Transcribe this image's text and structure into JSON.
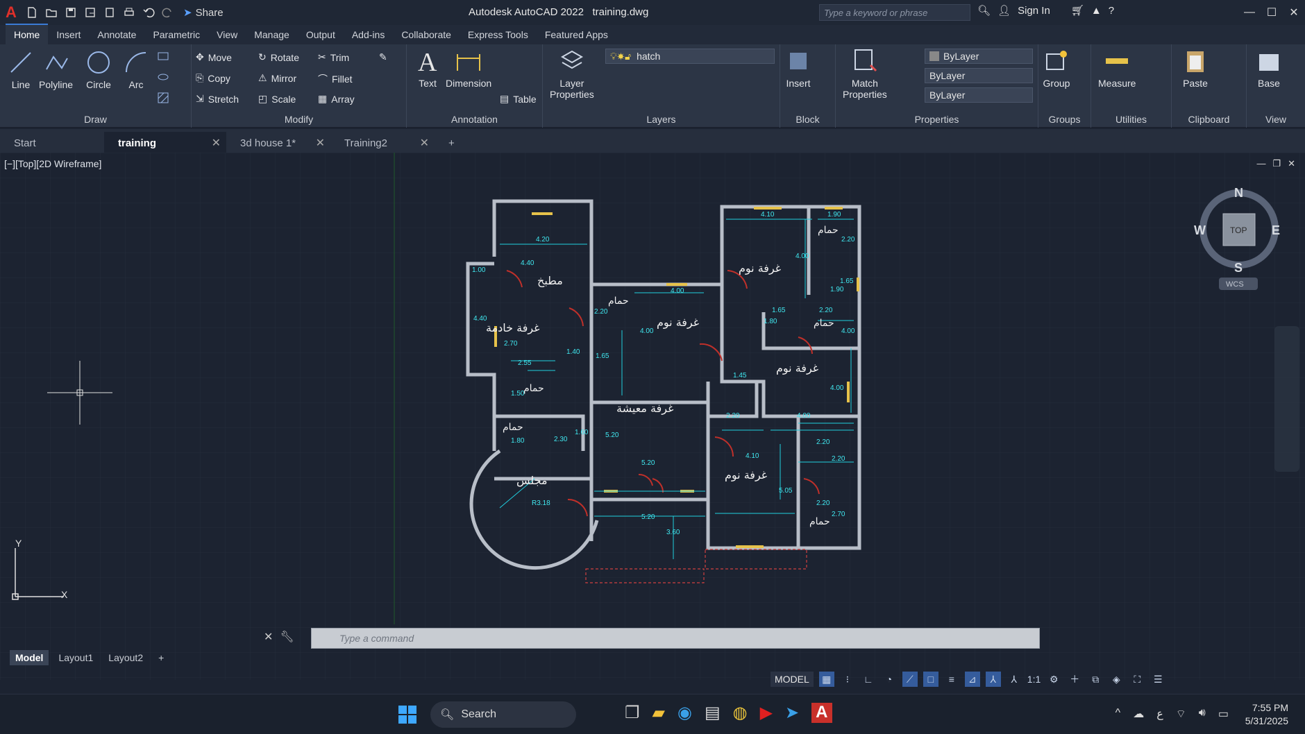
{
  "app": {
    "title": "Autodesk AutoCAD 2022",
    "file": "training.dwg",
    "share": "Share",
    "search_placeholder": "Type a keyword or phrase",
    "sign_in": "Sign In"
  },
  "ribbon_tabs": [
    "Home",
    "Insert",
    "Annotate",
    "Parametric",
    "View",
    "Manage",
    "Output",
    "Add-ins",
    "Collaborate",
    "Express Tools",
    "Featured Apps"
  ],
  "panels": {
    "draw": "Draw",
    "modify": "Modify",
    "annotation": "Annotation",
    "layers": "Layers",
    "block": "Block",
    "properties": "Properties",
    "groups": "Groups",
    "utilities": "Utilities",
    "clipboard": "Clipboard",
    "view": "View"
  },
  "draw_tools": {
    "line": "Line",
    "polyline": "Polyline",
    "circle": "Circle",
    "arc": "Arc"
  },
  "modify_tools": {
    "move": "Move",
    "rotate": "Rotate",
    "trim": "Trim",
    "copy": "Copy",
    "mirror": "Mirror",
    "fillet": "Fillet",
    "stretch": "Stretch",
    "scale": "Scale",
    "array": "Array"
  },
  "annotation_tools": {
    "text": "Text",
    "dimension": "Dimension",
    "table": "Table"
  },
  "layers_tools": {
    "layer_properties_1": "Layer",
    "layer_properties_2": "Properties",
    "current_layer": "hatch"
  },
  "block_tools": {
    "insert": "Insert"
  },
  "properties_tools": {
    "match_1": "Match",
    "match_2": "Properties",
    "color": "ByLayer",
    "linetype": "ByLayer",
    "lineweight": "ByLayer"
  },
  "group_tools": {
    "group": "Group"
  },
  "utility_tools": {
    "measure": "Measure"
  },
  "clipboard_tools": {
    "paste": "Paste"
  },
  "view_tools": {
    "base": "Base"
  },
  "doc_tabs": [
    {
      "label": "Start"
    },
    {
      "label": "training"
    },
    {
      "label": "3d house 1*"
    },
    {
      "label": "Training2"
    }
  ],
  "viewport": {
    "label": "[−][Top][2D Wireframe]",
    "wcs": "WCS",
    "cube": {
      "top": "TOP",
      "n": "N",
      "s": "S",
      "e": "E",
      "w": "W"
    },
    "ucs_y": "Y",
    "ucs_x": "X"
  },
  "plan": {
    "rooms": {
      "kitchen": "مطبخ",
      "maid": "غرفة خادمة",
      "bed1": "غرفة نوم",
      "bed2": "غرفة نوم",
      "bed3": "غرفة نوم",
      "bed4": "غرفة نوم",
      "living": "غرفة معيشة",
      "majlis": "مجلس",
      "bath": "حمام"
    },
    "dims": [
      "4.20",
      "4.40",
      "4.10",
      "1.90",
      "2.20",
      "4.00",
      "1.65",
      "1.90",
      "4.00",
      "2.20",
      "4.00",
      "1.65",
      "1.80",
      "1.65",
      "2.20",
      "4.00",
      "1.45",
      "2.20",
      "4.00",
      "4.00",
      "1.40",
      "2.55",
      "2.70",
      "1.50",
      "1.80",
      "2.30",
      "1.60",
      "5.20",
      "5.20",
      "4.10",
      "5.05",
      "2.20",
      "2.20",
      "2.20",
      "2.70",
      "5.20",
      "3.60",
      "R3.18",
      "1.00",
      "4.40"
    ]
  },
  "command": {
    "placeholder": "Type a command"
  },
  "layout_tabs": [
    "Model",
    "Layout1",
    "Layout2"
  ],
  "status": {
    "model": "MODEL",
    "scale": "1:1"
  },
  "taskbar": {
    "search": "Search",
    "time": "7:55 PM",
    "date": "5/31/2025",
    "lang": "ع"
  }
}
